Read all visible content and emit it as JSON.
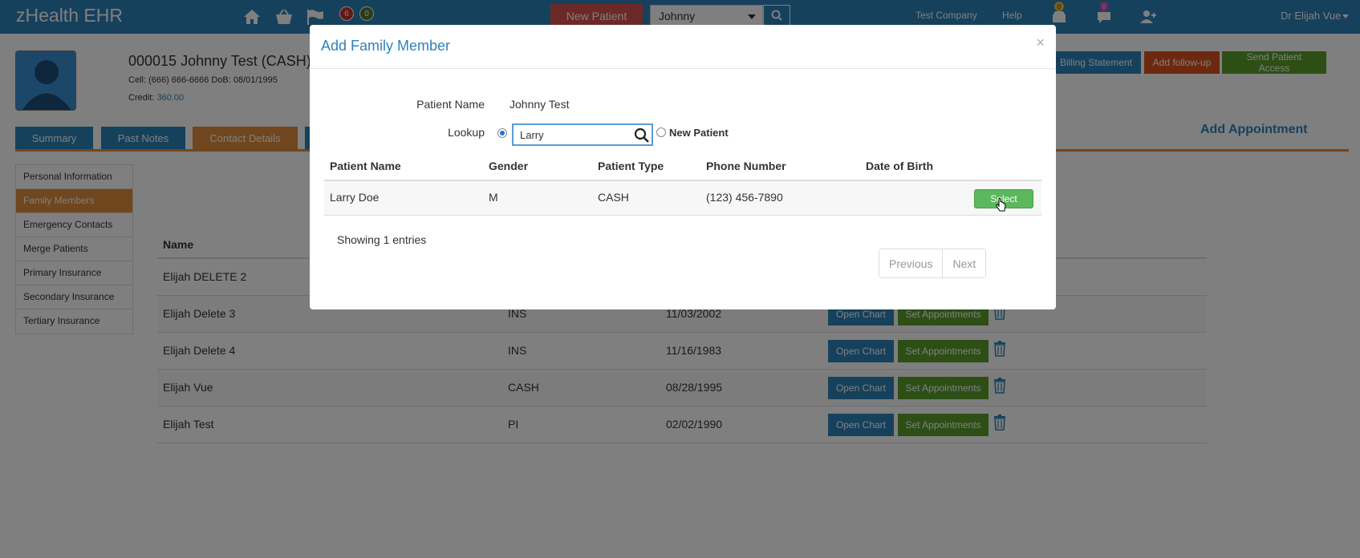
{
  "navbar": {
    "brand": "zHealth EHR",
    "badge_red": "6",
    "badge_green": "0",
    "new_patient": "New Patient",
    "patient_select": "Johnny",
    "company": "Test Company",
    "help": "Help",
    "msg_badge": "0",
    "chat_badge": "0",
    "user": "Dr Elijah Vue"
  },
  "patient": {
    "title": "000015 Johnny Test  (CASH)",
    "meta": "Cell: (666) 666-6666   DoB: 08/01/1995",
    "credit_label": "Credit:",
    "credit_value": "360.00"
  },
  "actions": {
    "billing": "Billing Statement",
    "followup": "Add follow-up",
    "access": "Send Patient Access"
  },
  "tabs": {
    "summary": "Summary",
    "past_notes": "Past Notes",
    "contact": "Contact Details",
    "add_appointment": "Add Appointment"
  },
  "sidebar": {
    "items": [
      "Personal Information",
      "Family Members",
      "Emergency Contacts",
      "Merge Patients",
      "Primary Insurance",
      "Secondary Insurance",
      "Tertiary Insurance"
    ]
  },
  "family": {
    "header_name": "Name",
    "rows": [
      {
        "name": "Elijah DELETE 2",
        "type": "",
        "dob": ""
      },
      {
        "name": "Elijah Delete 3",
        "type": "INS",
        "dob": "11/03/2002"
      },
      {
        "name": "Elijah Delete 4",
        "type": "INS",
        "dob": "11/16/1983"
      },
      {
        "name": "Elijah Vue",
        "type": "CASH",
        "dob": "08/28/1995"
      },
      {
        "name": "Elijah Test",
        "type": "PI",
        "dob": "02/02/1990"
      }
    ],
    "open_chart": "Open Chart",
    "set_appointments": "Set Appointments"
  },
  "modal": {
    "title": "Add Family Member",
    "close": "×",
    "patient_name_label": "Patient Name",
    "patient_name_value": "Johnny Test",
    "lookup_label": "Lookup",
    "lookup_value": "Larry",
    "new_patient_label": "New Patient",
    "columns": [
      "Patient Name",
      "Gender",
      "Patient Type",
      "Phone Number",
      "Date of Birth"
    ],
    "results": [
      {
        "name": "Larry Doe",
        "gender": "M",
        "type": "CASH",
        "phone": "(123) 456-7890",
        "dob": ""
      }
    ],
    "select": "Select",
    "showing": "Showing 1 entries",
    "previous": "Previous",
    "next": "Next"
  }
}
